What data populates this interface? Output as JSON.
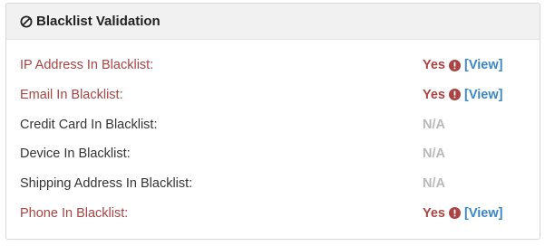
{
  "panel": {
    "title": "Blacklist Validation",
    "title_icon": "ban-icon"
  },
  "colors": {
    "flagged": "#a94442",
    "link": "#3a87c8",
    "not_available": "#b9b9b9",
    "header_bg": "#f1f1f1"
  },
  "rows": [
    {
      "label": "IP Address In Blacklist:",
      "status": "Yes",
      "flagged": true,
      "icon": "exclamation-circle-icon",
      "link": "[View]"
    },
    {
      "label": "Email In Blacklist:",
      "status": "Yes",
      "flagged": true,
      "icon": "exclamation-circle-icon",
      "link": "[View]"
    },
    {
      "label": "Credit Card In Blacklist:",
      "status": "N/A",
      "flagged": false
    },
    {
      "label": "Device In Blacklist:",
      "status": "N/A",
      "flagged": false
    },
    {
      "label": "Shipping Address In Blacklist:",
      "status": "N/A",
      "flagged": false
    },
    {
      "label": "Phone In Blacklist:",
      "status": "Yes",
      "flagged": true,
      "icon": "exclamation-circle-icon",
      "link": "[View]"
    }
  ]
}
